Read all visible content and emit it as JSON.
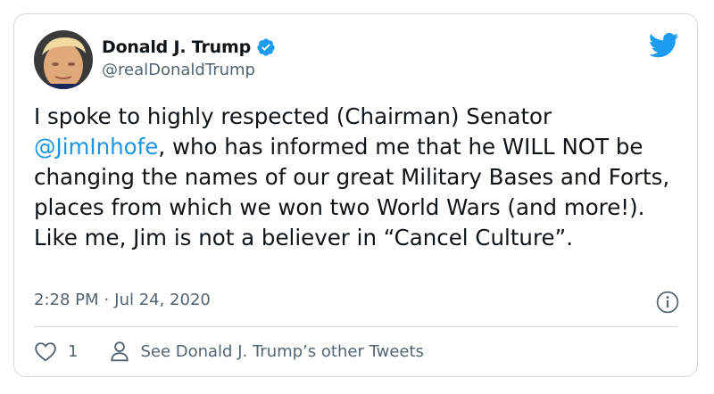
{
  "tweet": {
    "author": {
      "display_name": "Donald J. Trump",
      "handle": "@realDonaldTrump",
      "verified": true
    },
    "text": {
      "part1": "I spoke to highly respected (Chairman) Senator ",
      "mention": "@JimInhofe",
      "part2": ", who has informed me that he WILL NOT be changing the names of our great Military Bases and Forts, places from which we won two World Wars (and more!). Like me, Jim is not a believer in “Cancel Culture”."
    },
    "time": "2:28 PM",
    "separator": "·",
    "date": "Jul 24, 2020",
    "like_count": "1",
    "profile_link_label": "See Donald J. Trump’s other Tweets"
  },
  "icons": {
    "brand": "twitter-bird-icon",
    "verified": "verified-badge-icon",
    "info": "info-icon",
    "like": "heart-icon",
    "profile": "person-icon"
  },
  "colors": {
    "brand_blue": "#1d9bf0",
    "text_primary": "#0f1419",
    "text_secondary": "#536471",
    "mention_blue": "#1b95e0",
    "border": "#cfd9de"
  }
}
